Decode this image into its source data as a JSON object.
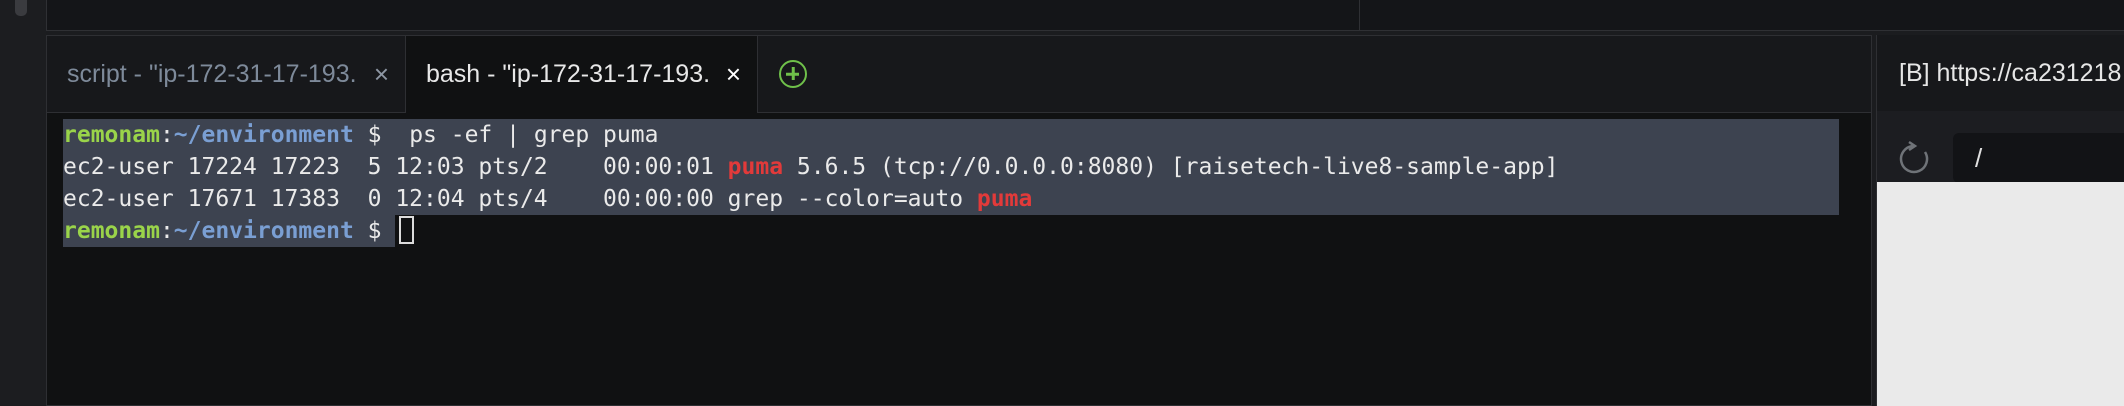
{
  "terminal": {
    "tabs": [
      {
        "title": "script - \"ip-172-31-17-193.",
        "close": "×",
        "active": false
      },
      {
        "title": "bash - \"ip-172-31-17-193.",
        "close": "×",
        "active": true
      }
    ],
    "add_tab_icon": "plus-circle-icon",
    "lines": [
      {
        "user": "remonam",
        "colon": ":",
        "path": "~/environment",
        "rest": " $  ps -ef | grep puma"
      },
      {
        "pre": "ec2-user 17224 17223  5 12:03 pts/2    00:00:01 ",
        "match": "puma",
        "post": " 5.6.5 (tcp://0.0.0.0:8080) [raisetech-live8-sample-app]"
      },
      {
        "pre": "ec2-user 17671 17383  0 12:04 pts/4    00:00:00 grep --color=auto ",
        "match": "puma",
        "post": ""
      },
      {
        "user": "remonam",
        "colon": ":",
        "path": "~/environment",
        "rest": " $ "
      }
    ]
  },
  "preview": {
    "tab_title": "[B] https://ca231218",
    "reload_icon": "reload-icon",
    "address": "/"
  },
  "colors": {
    "prompt_user": "#9ad44a",
    "prompt_path": "#7a9fd3",
    "match": "#e23a3a",
    "selection": "#3d4350",
    "add_tab": "#6fc04a"
  }
}
